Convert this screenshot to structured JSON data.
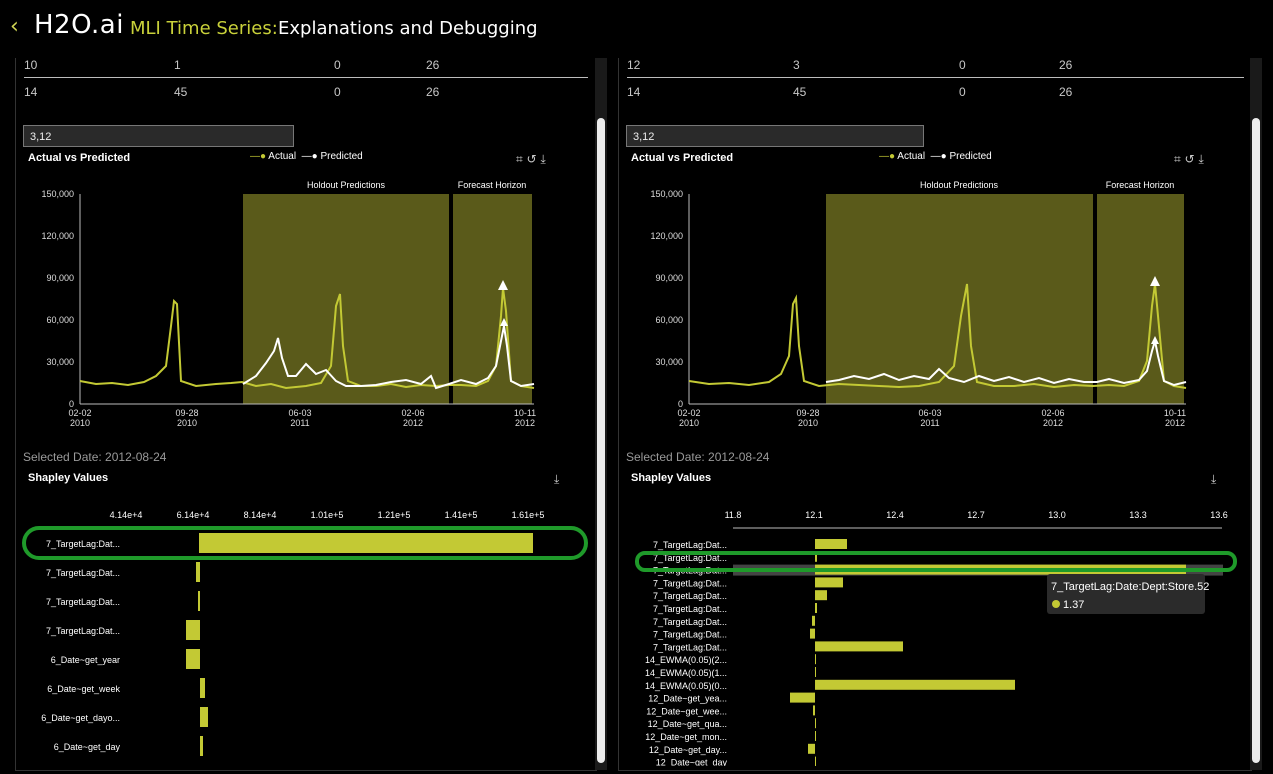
{
  "header": {
    "back_icon": "chevron-left-icon",
    "logo": "H2O.ai",
    "tag": "MLI Time Series:",
    "title": "Explanations and Debugging"
  },
  "colors": {
    "accent": "#c3c934",
    "highlight_ring": "#1f9a2a",
    "region": "#5a5a1a"
  },
  "panels": [
    {
      "table_rows": [
        [
          "10",
          "1",
          "0",
          "26"
        ],
        [
          "14",
          "45",
          "0",
          "26"
        ]
      ],
      "filter_value": "3,12",
      "chart": {
        "title": "Actual vs Predicted",
        "legend": [
          "Actual",
          "Predicted"
        ],
        "regions": [
          "Holdout Predictions",
          "Forecast Horizon"
        ],
        "y_ticks": [
          "150,000",
          "120,000",
          "90,000",
          "60,000",
          "30,000",
          "0"
        ],
        "x_ticks": [
          [
            "02-02",
            "2010"
          ],
          [
            "09-28",
            "2010"
          ],
          [
            "06-03",
            "2011"
          ],
          [
            "02-06",
            "2012"
          ],
          [
            "10-11",
            "2012"
          ]
        ]
      },
      "selected_date": "Selected Date: 2012-08-24",
      "shap": {
        "title": "Shapley Values",
        "axis": [
          "4.14e+4",
          "6.14e+4",
          "8.14e+4",
          "1.01e+5",
          "1.21e+5",
          "1.41e+5",
          "1.61e+5"
        ],
        "labels": [
          "7_TargetLag:Dat...",
          "7_TargetLag:Dat...",
          "7_TargetLag:Dat...",
          "7_TargetLag:Dat...",
          "6_Date~get_year",
          "6_Date~get_week",
          "6_Date~get_dayo...",
          "6_Date~get_day"
        ]
      }
    },
    {
      "table_rows": [
        [
          "12",
          "3",
          "0",
          "26"
        ],
        [
          "14",
          "45",
          "0",
          "26"
        ]
      ],
      "filter_value": "3,12",
      "chart": {
        "title": "Actual vs Predicted",
        "legend": [
          "Actual",
          "Predicted"
        ],
        "regions": [
          "Holdout Predictions",
          "Forecast Horizon"
        ],
        "y_ticks": [
          "150,000",
          "120,000",
          "90,000",
          "60,000",
          "30,000",
          "0"
        ],
        "x_ticks": [
          [
            "02-02",
            "2010"
          ],
          [
            "09-28",
            "2010"
          ],
          [
            "06-03",
            "2011"
          ],
          [
            "02-06",
            "2012"
          ],
          [
            "10-11",
            "2012"
          ]
        ]
      },
      "selected_date": "Selected Date: 2012-08-24",
      "shap": {
        "title": "Shapley Values",
        "axis": [
          "11.8",
          "12.1",
          "12.4",
          "12.7",
          "13.0",
          "13.3",
          "13.6"
        ],
        "labels": [
          "7_TargetLag:Dat...",
          "7_TargetLag:Dat...",
          "7_TargetLag:Dat...",
          "7_TargetLag:Dat...",
          "7_TargetLag:Dat...",
          "7_TargetLag:Dat...",
          "7_TargetLag:Dat...",
          "7_TargetLag:Dat...",
          "7_TargetLag:Dat...",
          "14_EWMA(0.05)(2...",
          "14_EWMA(0.05)(1...",
          "14_EWMA(0.05)(0...",
          "12_Date~get_yea...",
          "12_Date~get_wee...",
          "12_Date~get_qua...",
          "12_Date~get_mon...",
          "12_Date~get_day...",
          "12_Date~get_day"
        ],
        "tooltip": {
          "label": "7_TargetLag:Date:Dept:Store.52",
          "value": "1.37"
        }
      }
    }
  ]
}
